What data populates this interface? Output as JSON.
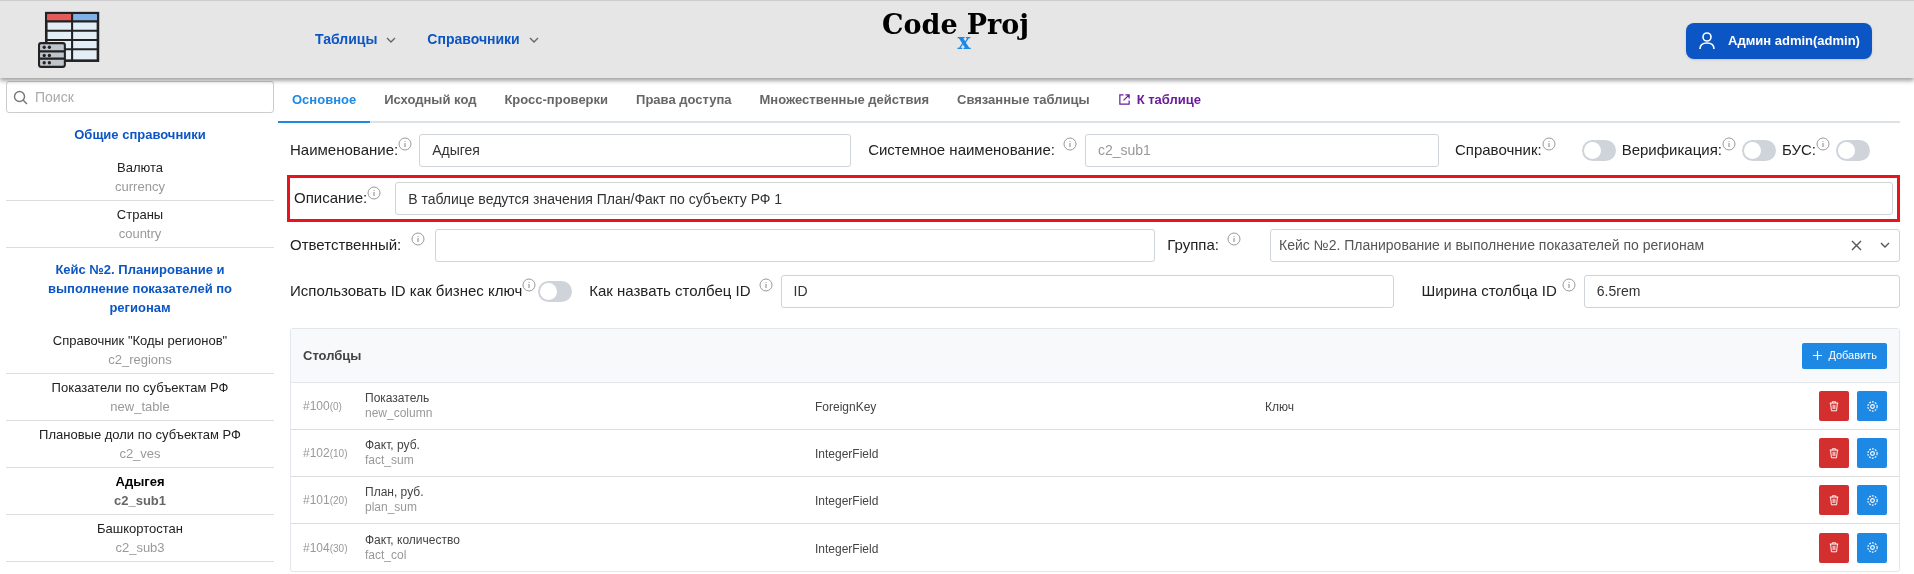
{
  "header": {
    "nav": [
      {
        "label": "Таблицы"
      },
      {
        "label": "Справочники"
      }
    ],
    "title": {
      "main_left": "Code",
      "main_right": "Proj",
      "sub": "x"
    },
    "user_button": "Админ admin(admin)"
  },
  "sidebar": {
    "search": {
      "placeholder": "Поиск"
    },
    "groups": [
      {
        "title": "Общие справочники",
        "items": [
          {
            "name": "Валюта",
            "code": "currency",
            "selected": false
          },
          {
            "name": "Страны",
            "code": "country",
            "selected": false
          }
        ]
      },
      {
        "title": "Кейс №2. Планирование и выполнение показателей по регионам",
        "items": [
          {
            "name": "Справочник \"Коды регионов\"",
            "code": "c2_regions",
            "selected": false
          },
          {
            "name": "Показатели по субъектам РФ",
            "code": "new_table",
            "selected": false
          },
          {
            "name": "Плановые доли по субъектам РФ",
            "code": "c2_ves",
            "selected": false
          },
          {
            "name": "Адыгея",
            "code": "c2_sub1",
            "selected": true
          },
          {
            "name": "Башкортостан",
            "code": "c2_sub3",
            "selected": false
          }
        ]
      }
    ]
  },
  "tabs": [
    {
      "label": "Основное",
      "selected": true,
      "kind": "tab"
    },
    {
      "label": "Исходный код",
      "selected": false,
      "kind": "tab"
    },
    {
      "label": "Кросс-проверки",
      "selected": false,
      "kind": "tab"
    },
    {
      "label": "Права доступа",
      "selected": false,
      "kind": "tab"
    },
    {
      "label": "Множественные действия",
      "selected": false,
      "kind": "tab"
    },
    {
      "label": "Связанные таблицы",
      "selected": false,
      "kind": "tab"
    },
    {
      "label": "К таблице",
      "selected": false,
      "kind": "link"
    }
  ],
  "form": {
    "name": {
      "label": "Наименование:",
      "value": "Адыгея"
    },
    "system_name": {
      "label": "Системное наименование:",
      "value": "c2_sub1",
      "disabled": true
    },
    "toggles": [
      {
        "label": "Справочник:",
        "on": false
      },
      {
        "label": "Верификация:",
        "on": false
      },
      {
        "label": "БУС:",
        "on": false
      }
    ],
    "description": {
      "label": "Описание:",
      "value": "В таблице ведутся значения План/Факт по субъекту РФ 1",
      "highlighted": true
    },
    "responsible": {
      "label": "Ответственный:"
    },
    "group": {
      "label": "Группа:",
      "value": "Кейс №2. Планирование и выполнение показателей по регионам"
    },
    "id_business_key": {
      "label": "Использовать ID как бизнес ключ",
      "on": false
    },
    "id_column_name": {
      "label": "Как назвать столбец ID",
      "value": "ID"
    },
    "id_column_width": {
      "label": "Ширина столбца ID",
      "value": "6.5rem"
    }
  },
  "columns_card": {
    "title": "Столбцы",
    "add_button": "Добавить",
    "rows": [
      {
        "id": "#100",
        "order": "(0)",
        "name": "Показатель",
        "code": "new_column",
        "type": "ForeignKey",
        "extra": "Ключ"
      },
      {
        "id": "#102",
        "order": "(10)",
        "name": "Факт, руб.",
        "code": "fact_sum",
        "type": "IntegerField"
      },
      {
        "id": "#101",
        "order": "(20)",
        "name": "План, руб.",
        "code": "plan_sum",
        "type": "IntegerField"
      },
      {
        "id": "#104",
        "order": "(30)",
        "name": "Факт, количество",
        "code": "fact_col",
        "type": "IntegerField"
      }
    ]
  }
}
